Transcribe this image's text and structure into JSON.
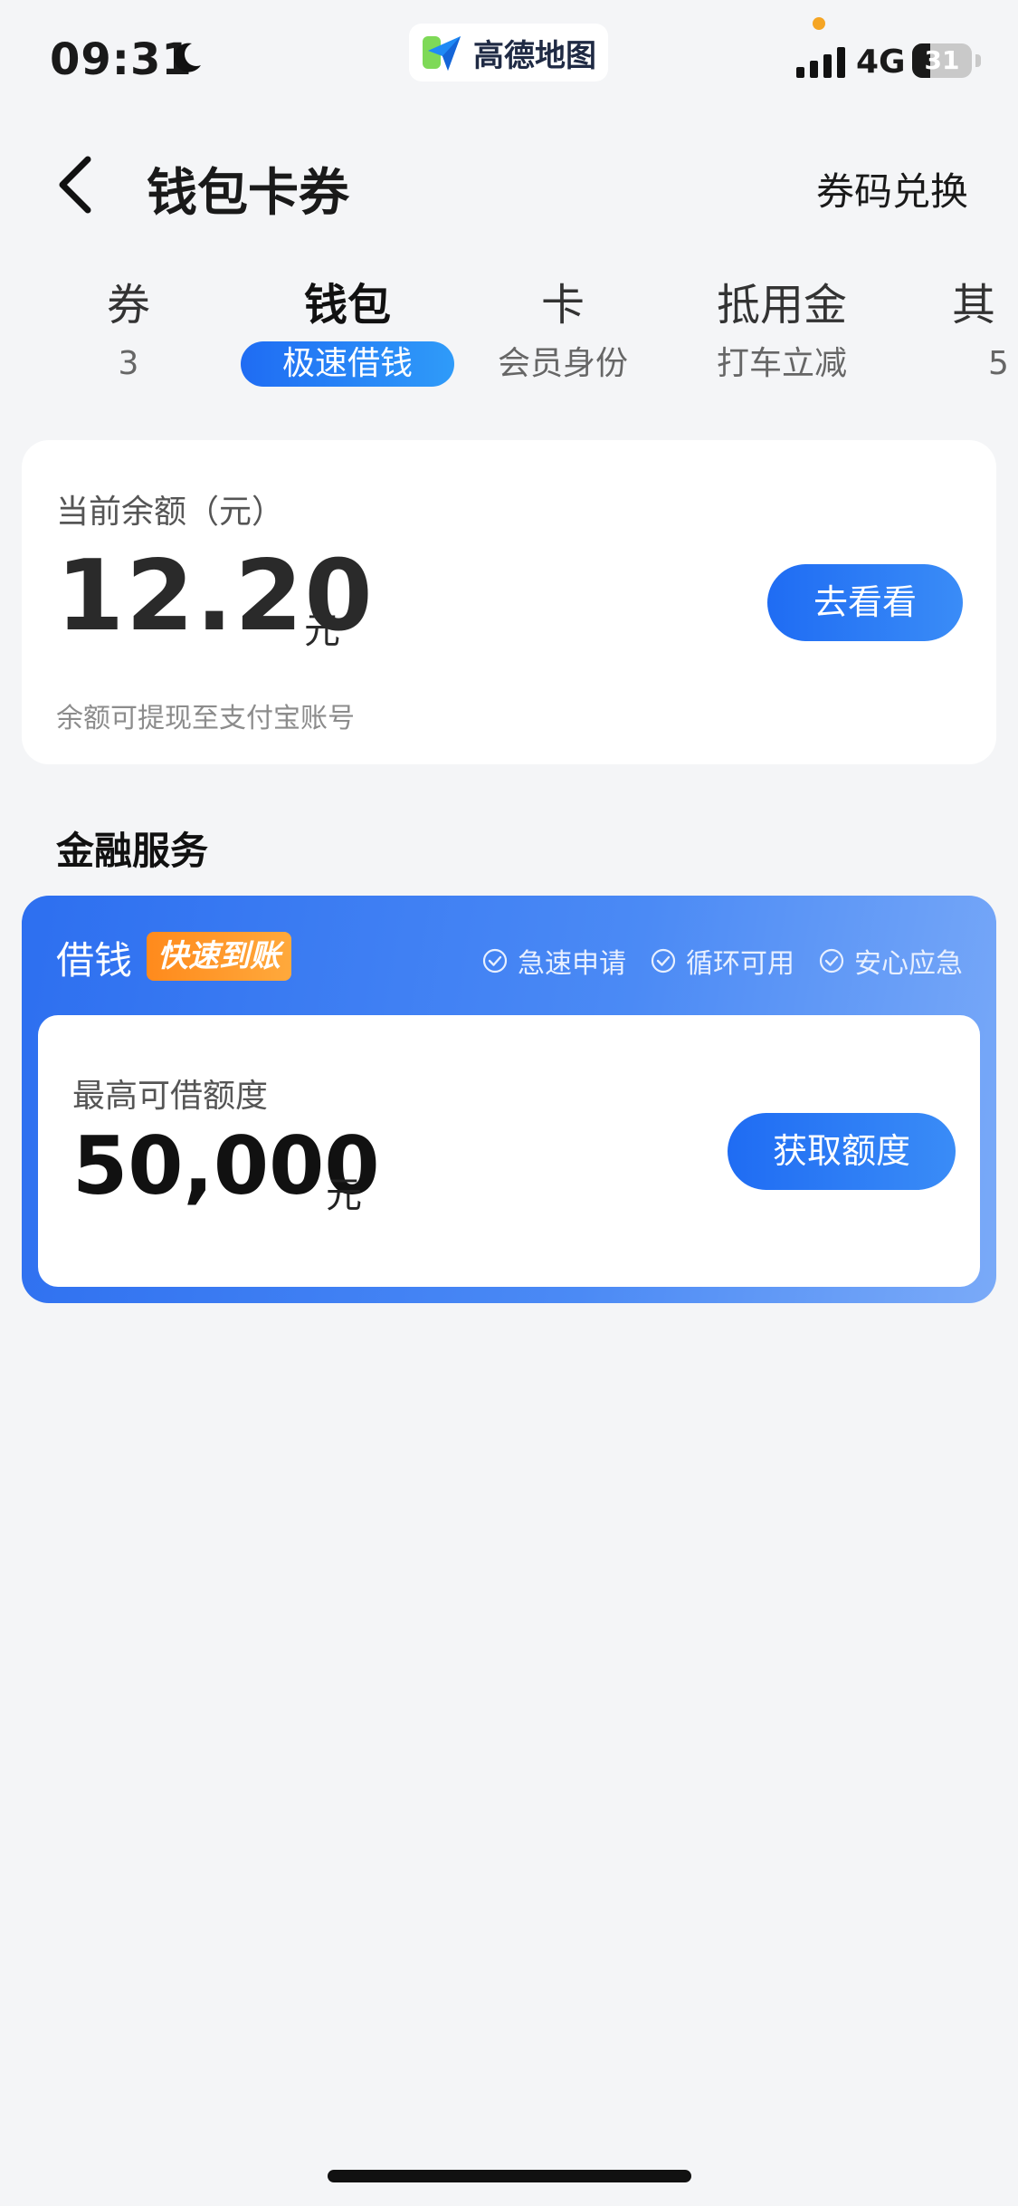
{
  "status_bar": {
    "time": "09:31",
    "app_name": "高德地图",
    "network": "4G",
    "battery": "31",
    "battery_level": 0.31
  },
  "nav": {
    "title": "钱包卡券",
    "redeem_label": "券码兑换"
  },
  "tabs": [
    {
      "label": "券",
      "sub": "3"
    },
    {
      "label": "钱包",
      "sub": "极速借钱"
    },
    {
      "label": "卡",
      "sub": "会员身份"
    },
    {
      "label": "抵用金",
      "sub": "打车立减"
    },
    {
      "label": "其",
      "sub": "5"
    }
  ],
  "balance": {
    "label": "当前余额（元）",
    "amount": "12.20",
    "unit": "元",
    "button": "去看看",
    "note": "余额可提现至支付宝账号"
  },
  "finance": {
    "section_title": "金融服务",
    "loan_title": "借钱",
    "badge": "快速到账",
    "features": [
      "急速申请",
      "循环可用",
      "安心应急"
    ],
    "limit_label": "最高可借额度",
    "limit_amount": "50,000",
    "limit_unit": "元",
    "button": "获取额度"
  },
  "colors": {
    "accent": "#1f6cf3",
    "badge": "#ff8a1c",
    "background": "#f4f5f7"
  }
}
